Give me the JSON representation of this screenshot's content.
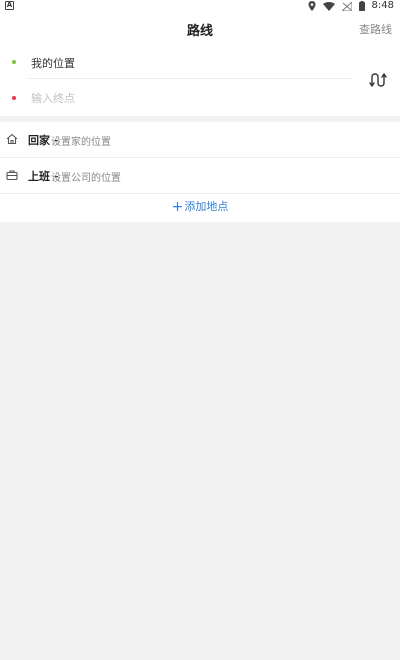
{
  "status_bar": {
    "time": "8:48",
    "left_badge": "A",
    "icons": [
      "location-icon",
      "wifi-icon",
      "signal-off-icon",
      "battery-icon"
    ]
  },
  "header": {
    "title": "路线",
    "action_label": "查路线"
  },
  "route": {
    "origin_label": "我的位置",
    "destination_placeholder": "输入终点",
    "destination_value": ""
  },
  "places": {
    "home": {
      "label": "回家",
      "separator": " - ",
      "hint": "设置家的位置"
    },
    "work": {
      "label": "上班",
      "separator": " - ",
      "hint": "设置公司的位置"
    },
    "add_label": "添加地点",
    "add_icon": "+"
  },
  "colors": {
    "origin_dot": "#7ac143",
    "destination_dot": "#e63950",
    "link_blue": "#2f7fd6"
  }
}
